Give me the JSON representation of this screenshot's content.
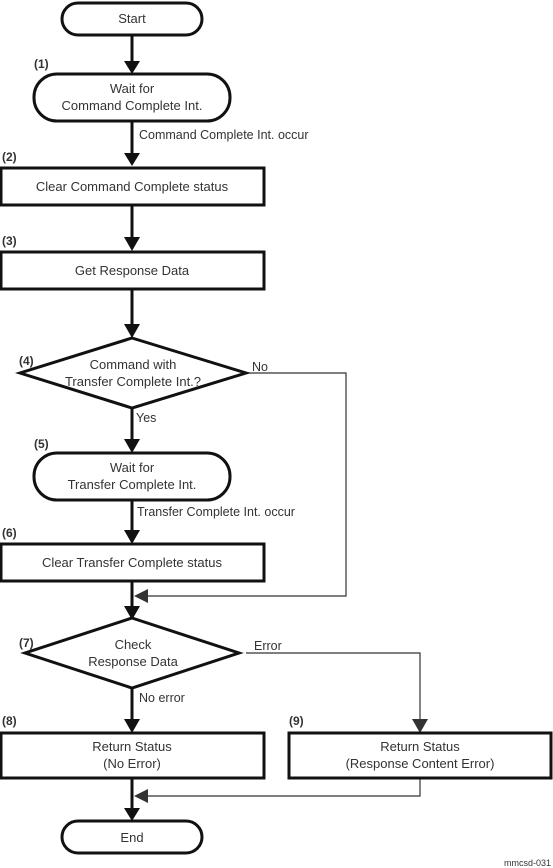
{
  "nodes": {
    "start": {
      "lines": [
        "Start"
      ]
    },
    "s1": {
      "step": "(1)",
      "lines": [
        "Wait for",
        "Command Complete Int."
      ]
    },
    "s2": {
      "step": "(2)",
      "lines": [
        "Clear Command Complete status"
      ]
    },
    "s3": {
      "step": "(3)",
      "lines": [
        "Get Response Data"
      ]
    },
    "s4": {
      "step": "(4)",
      "lines": [
        "Command with",
        "Transfer Complete Int.?"
      ]
    },
    "s5": {
      "step": "(5)",
      "lines": [
        "Wait for",
        "Transfer Complete Int."
      ]
    },
    "s6": {
      "step": "(6)",
      "lines": [
        "Clear Transfer Complete status"
      ]
    },
    "s7": {
      "step": "(7)",
      "lines": [
        "Check",
        "Response Data"
      ]
    },
    "s8": {
      "step": "(8)",
      "lines": [
        "Return Status",
        "(No Error)"
      ]
    },
    "s9": {
      "step": "(9)",
      "lines": [
        "Return Status",
        "(Response Content Error)"
      ]
    },
    "end": {
      "lines": [
        "End"
      ]
    }
  },
  "edge_labels": {
    "cmd_occur": "Command Complete Int. occur",
    "no": "No",
    "yes": "Yes",
    "xfer_occur": "Transfer Complete Int. occur",
    "error": "Error",
    "no_error": "No error"
  },
  "figure_id": "mmcsd-031"
}
